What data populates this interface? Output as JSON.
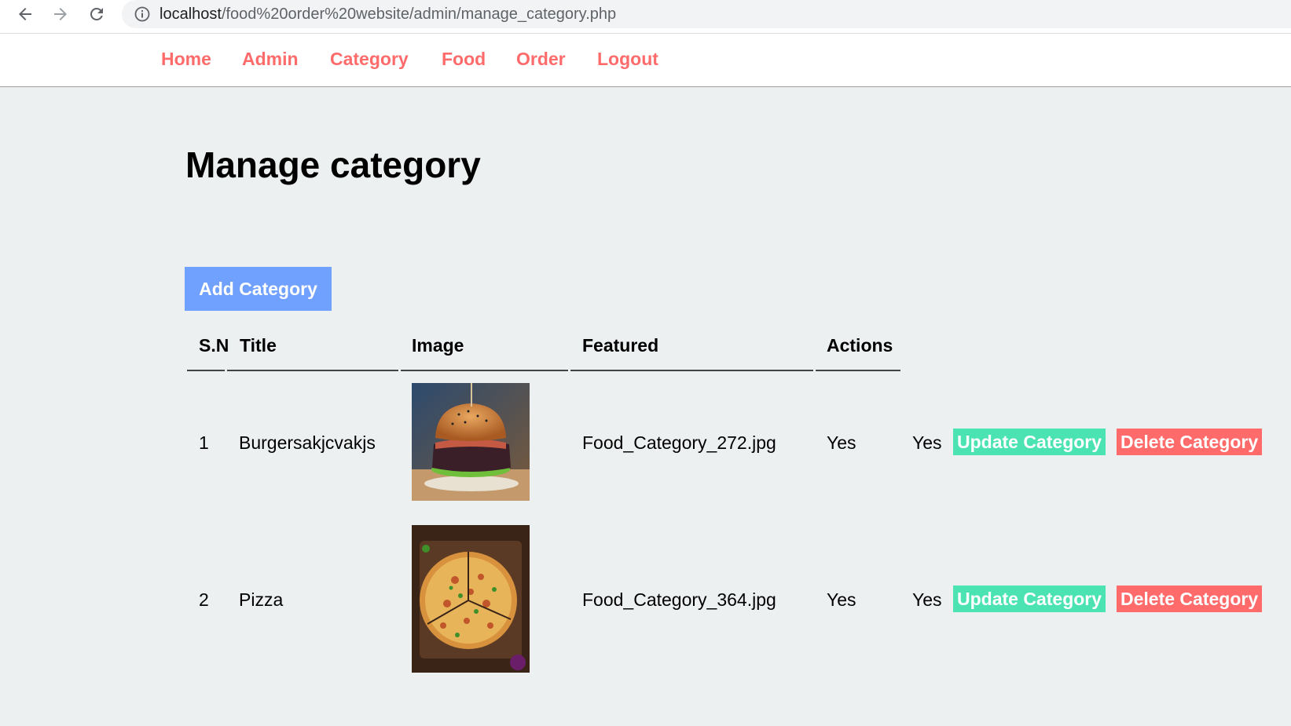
{
  "browser": {
    "url_host": "localhost",
    "url_path": "/food%20order%20website/admin/manage_category.php"
  },
  "nav": {
    "home": "Home",
    "admin": "Admin",
    "category": "Category",
    "food": "Food",
    "order": "Order",
    "logout": "Logout"
  },
  "page": {
    "title": "Manage category",
    "add_button": "Add Category"
  },
  "table": {
    "headers": [
      "S.N",
      "Title",
      "Image",
      "Featured",
      "Actions"
    ],
    "rows": [
      {
        "sn": "1",
        "title": "Burgersakjcvakjs",
        "image_name": "Food_Category_272.jpg",
        "featured": "Yes",
        "active": "Yes",
        "update_label": "Update Category",
        "delete_label": "Delete Category",
        "image_icon": "burger-image"
      },
      {
        "sn": "2",
        "title": "Pizza",
        "image_name": "Food_Category_364.jpg",
        "featured": "Yes",
        "active": "Yes",
        "update_label": "Update Category",
        "delete_label": "Delete Category",
        "image_icon": "pizza-image"
      }
    ]
  },
  "colors": {
    "nav_link": "#ff6b6b",
    "add_button": "#70a1ff",
    "update_button": "#4ce3b2",
    "delete_button": "#ff6b6b",
    "background": "#ecf0f1"
  }
}
